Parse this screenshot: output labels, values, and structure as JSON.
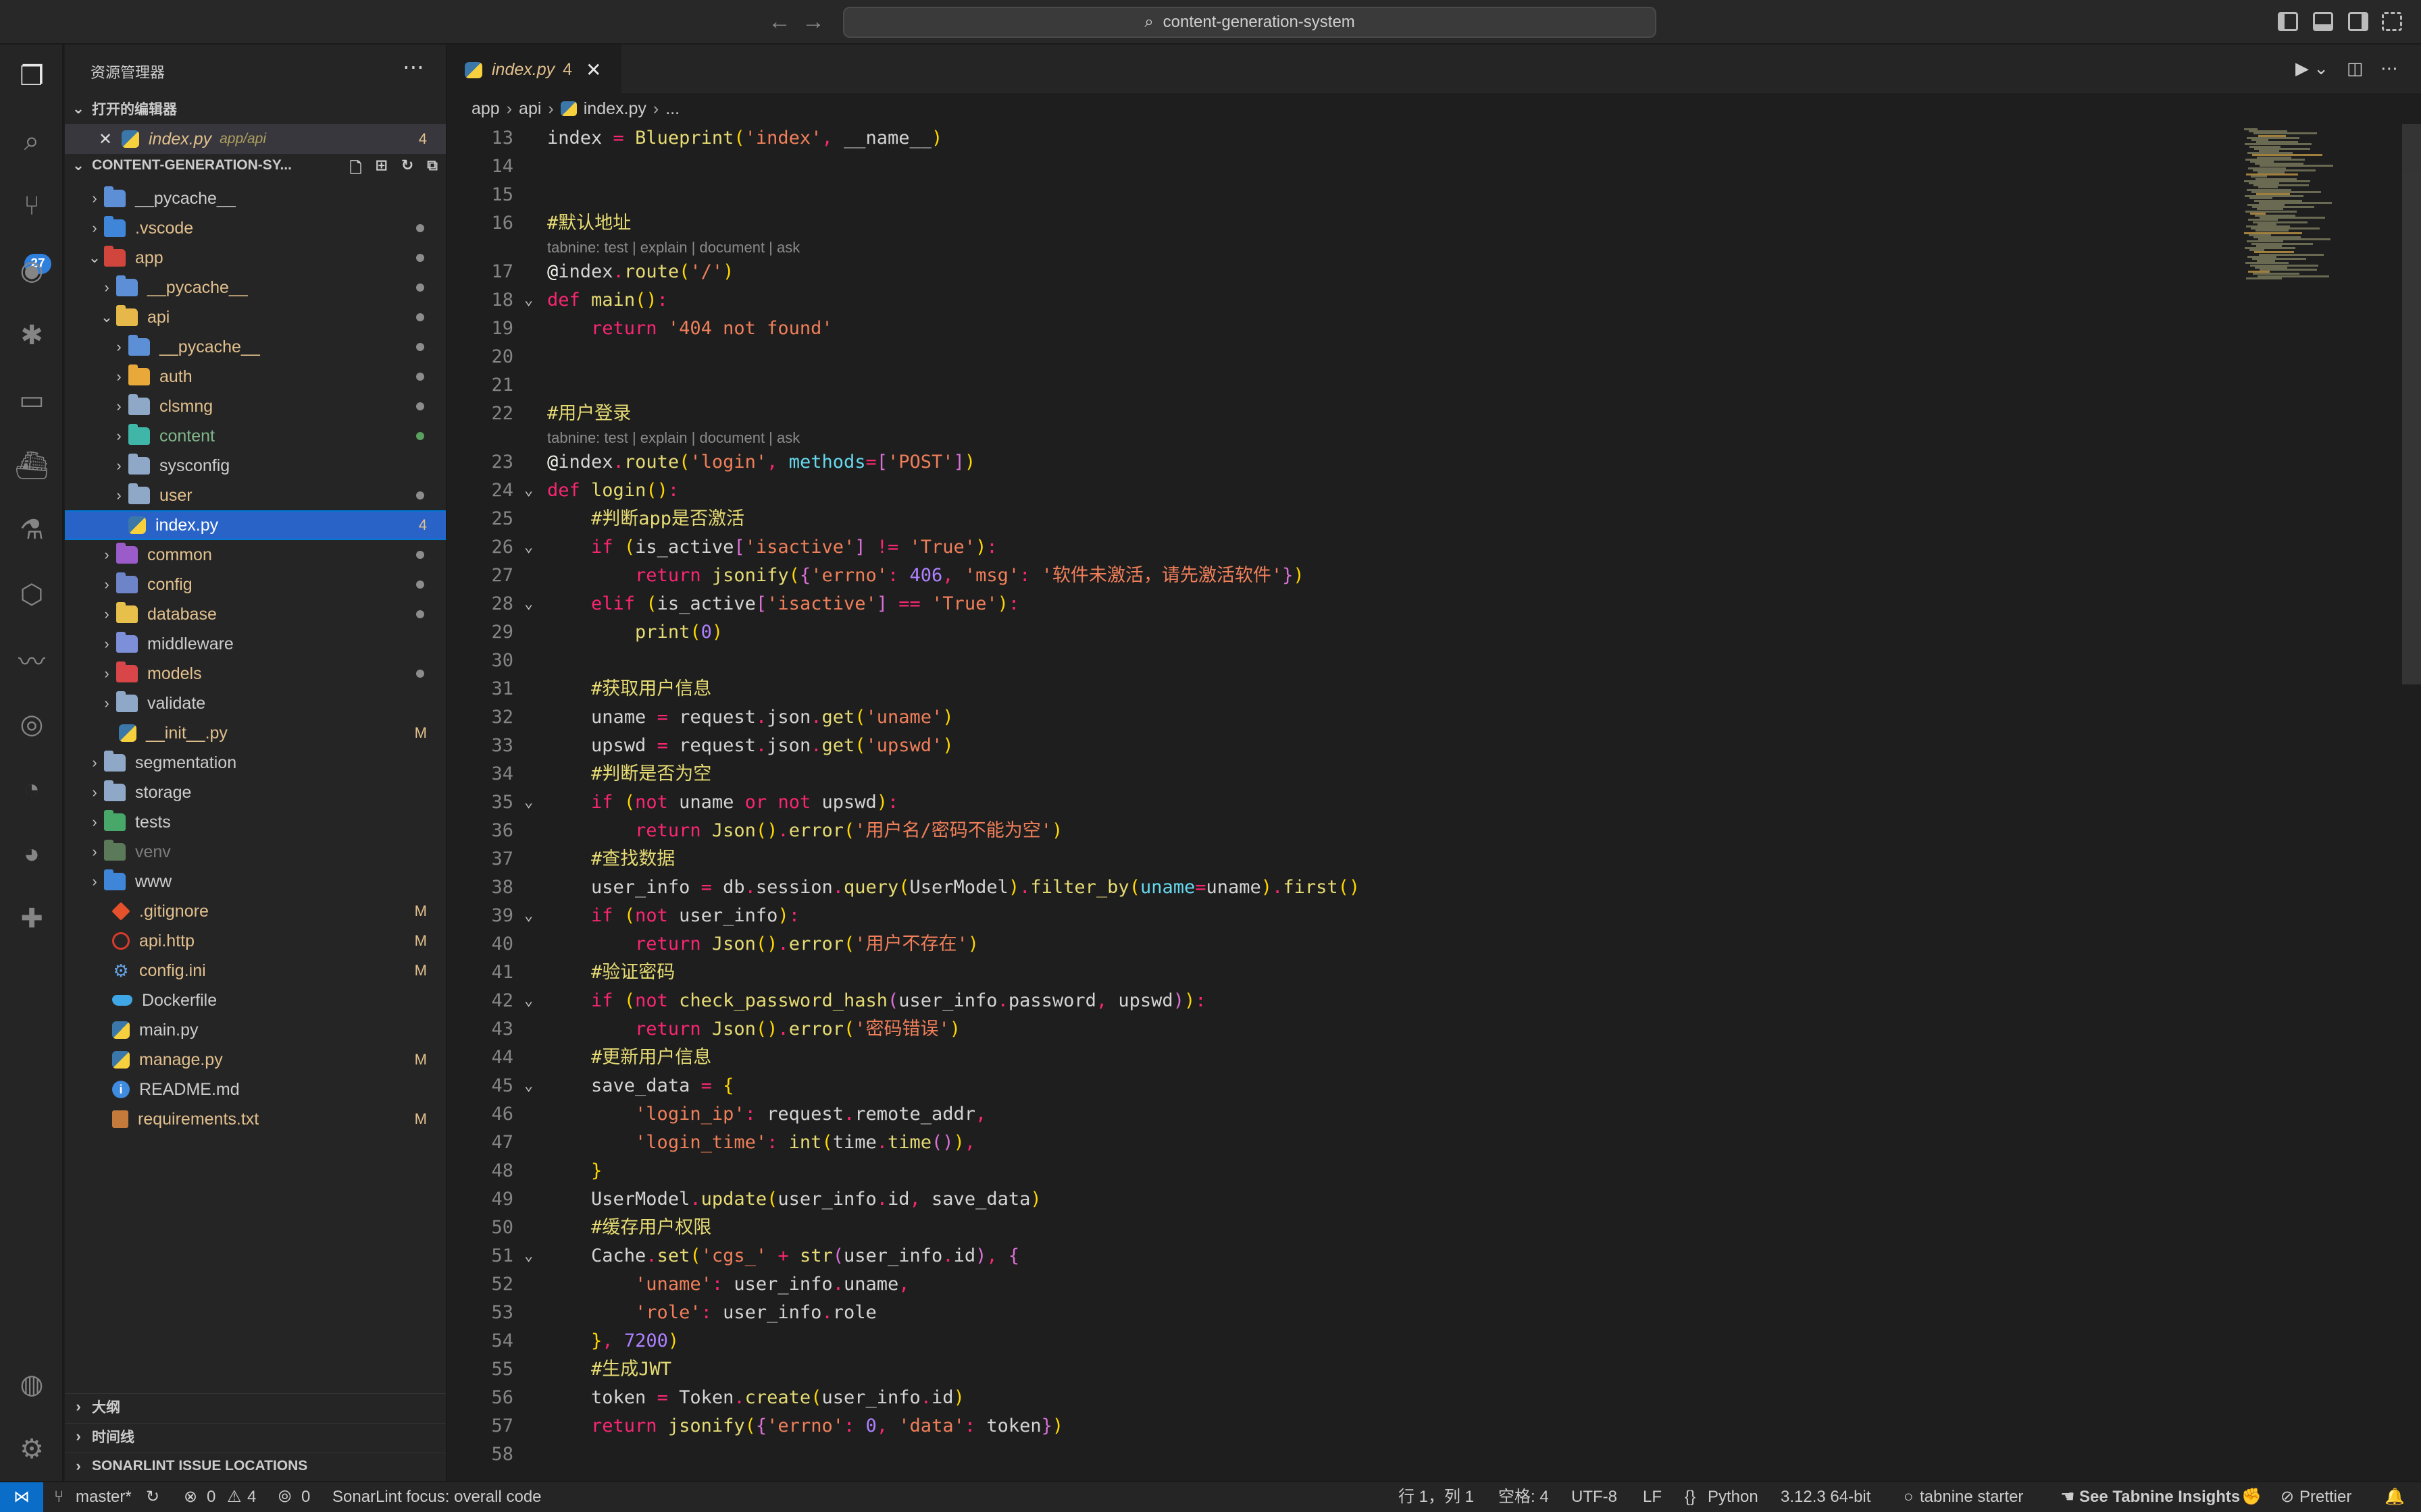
{
  "titlebar": {
    "search_text": "content-generation-system"
  },
  "activitybar": {
    "scm_badge": "27"
  },
  "sidebar": {
    "title": "资源管理器",
    "open_editors_label": "打开的编辑器",
    "open_editor": {
      "name": "index.py",
      "path": "app/api",
      "count": "4"
    },
    "project_label": "CONTENT-GENERATION-SY...",
    "outline_label": "大纲",
    "timeline_label": "时间线",
    "sonarlint_label": "SONARLINT ISSUE LOCATIONS",
    "tree": [
      {
        "name": "__pycache__",
        "badge": ""
      },
      {
        "name": ".vscode",
        "badge": ""
      },
      {
        "name": "app",
        "badge": ""
      },
      {
        "name": "__pycache__",
        "badge": ""
      },
      {
        "name": "api",
        "badge": ""
      },
      {
        "name": "__pycache__",
        "badge": ""
      },
      {
        "name": "auth",
        "badge": ""
      },
      {
        "name": "clsmng",
        "badge": ""
      },
      {
        "name": "content",
        "badge": ""
      },
      {
        "name": "sysconfig",
        "badge": ""
      },
      {
        "name": "user",
        "badge": ""
      },
      {
        "name": "index.py",
        "badge": "4"
      },
      {
        "name": "common",
        "badge": ""
      },
      {
        "name": "config",
        "badge": ""
      },
      {
        "name": "database",
        "badge": ""
      },
      {
        "name": "middleware",
        "badge": ""
      },
      {
        "name": "models",
        "badge": ""
      },
      {
        "name": "validate",
        "badge": ""
      },
      {
        "name": "__init__.py",
        "badge": "M"
      },
      {
        "name": "segmentation",
        "badge": ""
      },
      {
        "name": "storage",
        "badge": ""
      },
      {
        "name": "tests",
        "badge": ""
      },
      {
        "name": "venv",
        "badge": ""
      },
      {
        "name": "www",
        "badge": ""
      },
      {
        "name": ".gitignore",
        "badge": "M"
      },
      {
        "name": "api.http",
        "badge": "M"
      },
      {
        "name": "config.ini",
        "badge": "M"
      },
      {
        "name": "Dockerfile",
        "badge": ""
      },
      {
        "name": "main.py",
        "badge": ""
      },
      {
        "name": "manage.py",
        "badge": "M"
      },
      {
        "name": "README.md",
        "badge": ""
      },
      {
        "name": "requirements.txt",
        "badge": "M"
      }
    ]
  },
  "editor": {
    "tab_name": "index.py",
    "tab_count": "4",
    "breadcrumb": [
      "app",
      "api",
      "index.py",
      "..."
    ],
    "code_lens": "tabnine: test | explain | document | ask",
    "line_numbers": [
      "13",
      "14",
      "15",
      "16",
      "17",
      "18",
      "19",
      "20",
      "21",
      "22",
      "23",
      "24",
      "25",
      "26",
      "27",
      "28",
      "29",
      "30",
      "31",
      "32",
      "33",
      "34",
      "35",
      "36",
      "37",
      "38",
      "39",
      "40",
      "41",
      "42",
      "43",
      "44",
      "45",
      "46",
      "47",
      "48",
      "49",
      "50",
      "51",
      "52",
      "53",
      "54",
      "55",
      "56",
      "57",
      "58"
    ],
    "code": [
      "index = Blueprint('index', __name__)",
      "",
      "",
      "#默认地址",
      "@index.route('/')",
      "def main():",
      "    return '404 not found'",
      "",
      "",
      "#用户登录",
      "@index.route('login', methods=['POST'])",
      "def login():",
      "    #判断app是否激活",
      "    if (is_active['isactive'] != 'True'):",
      "        return jsonify({'errno': 406, 'msg': '软件未激活，请先激活软件'})",
      "    elif (is_active['isactive'] == 'True'):",
      "        print(0)",
      "",
      "    #获取用户信息",
      "    uname = request.json.get('uname')",
      "    upswd = request.json.get('upswd')",
      "    #判断是否为空",
      "    if (not uname or not upswd):",
      "        return Json().error('用户名/密码不能为空')",
      "    #查找数据",
      "    user_info = db.session.query(UserModel).filter_by(uname=uname).first()",
      "    if (not user_info):",
      "        return Json().error('用户不存在')",
      "    #验证密码",
      "    if (not check_password_hash(user_info.password, upswd)):",
      "        return Json().error('密码错误')",
      "    #更新用户信息",
      "    save_data = {",
      "        'login_ip': request.remote_addr,",
      "        'login_time': int(time.time()),",
      "    }",
      "    UserModel.update(user_info.id, save_data)",
      "    #缓存用户权限",
      "    Cache.set('cgs_' + str(user_info.id), {",
      "        'uname': user_info.uname,",
      "        'role': user_info.role",
      "    }, 7200)",
      "    #生成JWT",
      "    token = Token.create(user_info.id)",
      "    return jsonify({'errno': 0, 'data': token})",
      ""
    ]
  },
  "statusbar": {
    "branch": "master*",
    "errors": "0",
    "warnings": "4",
    "ports": "0",
    "sonarlint": "SonarLint focus: overall code",
    "position": "行 1，列 1",
    "spaces": "空格: 4",
    "encoding": "UTF-8",
    "eol": "LF",
    "language": "Python",
    "interpreter": "3.12.3 64-bit",
    "tabnine": "tabnine starter",
    "tabnine_insights": "See Tabnine Insights",
    "prettier": "Prettier"
  },
  "colors": {
    "accent": "#0a6ec8",
    "selection": "#2a63c8",
    "modified": "#e2c08d"
  }
}
